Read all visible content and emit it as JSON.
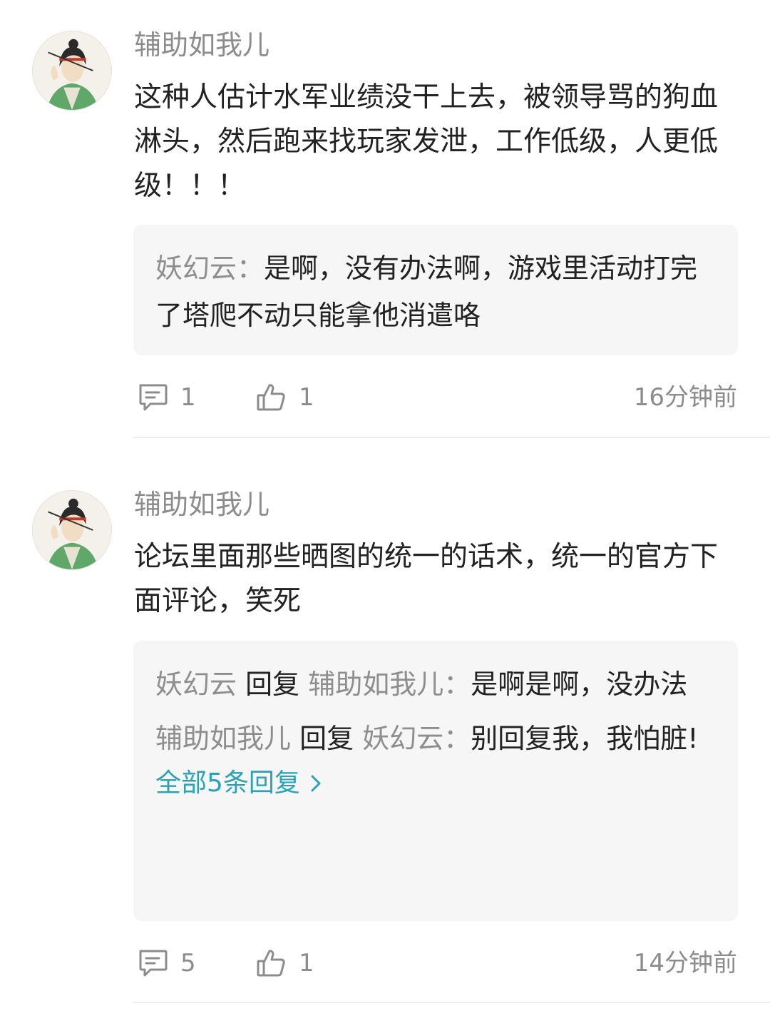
{
  "comments": [
    {
      "author": "辅助如我儿",
      "text": "这种人估计水军业绩没干上去，被领导骂的狗血淋头，然后跑来找玩家发泄，工作低级，人更低级！！！",
      "replies": [
        {
          "user": "妖幻云",
          "verb": "",
          "target": "",
          "sep": "：",
          "text": "是啊，没有办法啊，游戏里活动打完了塔爬不动只能拿他消遣咯"
        }
      ],
      "more_label": "",
      "comment_count": "1",
      "like_count": "1",
      "time": "16分钟前"
    },
    {
      "author": "辅助如我儿",
      "text": "论坛里面那些晒图的统一的话术，统一的官方下面评论，笑死",
      "replies": [
        {
          "user": "妖幻云",
          "verb": "回复",
          "target": "辅助如我儿",
          "sep": "：",
          "text": "是啊是啊，没办法"
        },
        {
          "user": "辅助如我儿",
          "verb": "回复",
          "target": "妖幻云",
          "sep": "：",
          "text": "别回复我，我怕脏!"
        }
      ],
      "more_label": "全部5条回复",
      "comment_count": "5",
      "like_count": "1",
      "time": "14分钟前"
    }
  ],
  "icons": {
    "comment": "comment-bubble-icon",
    "like": "thumbs-up-icon",
    "more": "chevron-right-icon"
  },
  "colors": {
    "link": "#2aa3b4",
    "muted": "#8c8c8c",
    "reply_bg": "#f6f6f6"
  }
}
